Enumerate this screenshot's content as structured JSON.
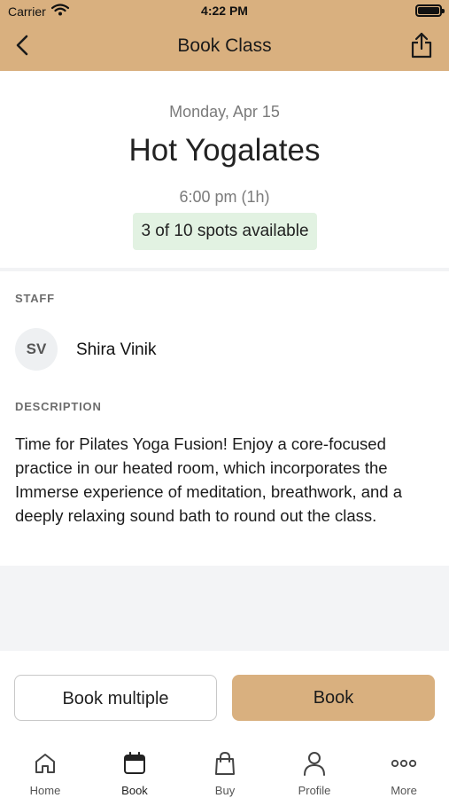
{
  "status_bar": {
    "carrier": "Carrier",
    "time": "4:22 PM"
  },
  "nav": {
    "title": "Book Class"
  },
  "class": {
    "date": "Monday, Apr 15",
    "name": "Hot Yogalates",
    "time": "6:00 pm (1h)",
    "spots": "3 of 10 spots available"
  },
  "staff": {
    "label": "STAFF",
    "initials": "SV",
    "name": "Shira Vinik"
  },
  "description": {
    "label": "DESCRIPTION",
    "text": "Time for Pilates Yoga Fusion! Enjoy a core-focused practice in our heated room, which incorporates the Immerse experience of meditation, breathwork, and a deeply relaxing sound bath to round out the class."
  },
  "actions": {
    "book_multiple": "Book multiple",
    "book": "Book"
  },
  "tabs": [
    {
      "label": "Home",
      "icon": "home-icon"
    },
    {
      "label": "Book",
      "icon": "calendar-icon"
    },
    {
      "label": "Buy",
      "icon": "shopping-bag-icon"
    },
    {
      "label": "Profile",
      "icon": "person-icon"
    },
    {
      "label": "More",
      "icon": "more-dots-icon"
    }
  ],
  "colors": {
    "accent": "#d9b07f",
    "spots_bg": "#e2f2e2"
  }
}
